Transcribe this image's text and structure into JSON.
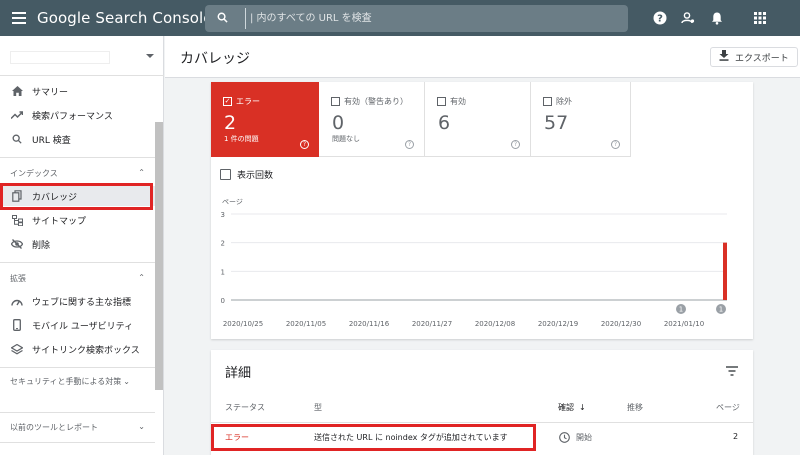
{
  "app": {
    "title": "Google Search Console",
    "search_placeholder": "| 内のすべての URL を検査"
  },
  "topbar_icons": [
    "help-icon",
    "account-settings-icon",
    "notifications-icon",
    "apps-grid-icon"
  ],
  "sidebar": {
    "property_value": "",
    "items_top": [
      {
        "label": "サマリー",
        "icon": "home-icon"
      },
      {
        "label": "検索パフォーマンス",
        "icon": "trending-up-icon"
      },
      {
        "label": "URL 検査",
        "icon": "search-icon"
      }
    ],
    "section_index": {
      "title": "インデックス"
    },
    "items_index": [
      {
        "label": "カバレッジ",
        "icon": "file-copy-icon"
      },
      {
        "label": "サイトマップ",
        "icon": "sitemap-icon"
      },
      {
        "label": "削除",
        "icon": "visibility-off-icon"
      }
    ],
    "section_enhance": {
      "title": "拡張"
    },
    "items_enhance": [
      {
        "label": "ウェブに関する主な指標",
        "icon": "speed-icon"
      },
      {
        "label": "モバイル ユーザビリティ",
        "icon": "smartphone-icon"
      },
      {
        "label": "サイトリンク検索ボックス",
        "icon": "layers-icon"
      }
    ],
    "section_security": {
      "title": "セキュリティと手動による対策"
    },
    "section_legacy": {
      "title": "以前のツールとレポート"
    }
  },
  "header": {
    "title": "カバレッジ",
    "export_label": "エクスポート"
  },
  "tiles": [
    {
      "label": "エラー",
      "count": "2",
      "sub": "1 件の問題",
      "checked": true
    },
    {
      "label": "有効（警告あり）",
      "count": "0",
      "sub": "問題なし",
      "checked": false
    },
    {
      "label": "有効",
      "count": "6",
      "sub": "",
      "checked": false
    },
    {
      "label": "除外",
      "count": "57",
      "sub": "",
      "checked": false
    }
  ],
  "impressions_label": "表示回数",
  "chart_data": {
    "type": "bar",
    "ylabel": "ページ",
    "ylim": [
      0,
      3
    ],
    "yticks": [
      "0",
      "1",
      "2",
      "3"
    ],
    "xticks": [
      "2020/10/25",
      "2020/11/05",
      "2020/11/16",
      "2020/11/27",
      "2020/12/08",
      "2020/12/19",
      "2020/12/30",
      "2021/01/10"
    ],
    "series": [
      {
        "values": [
          0,
          0,
          0,
          0,
          0,
          0,
          0,
          0,
          2
        ]
      }
    ],
    "annotations": [
      "1",
      "1"
    ],
    "color": "#d93025"
  },
  "details": {
    "title": "詳細",
    "columns": [
      "ステータス",
      "型",
      "確認",
      "推移",
      "ページ"
    ],
    "rows": [
      {
        "status": "エラー",
        "type": "送信された URL に noindex タグが追加されています",
        "validation": "開始",
        "pages": "2"
      }
    ]
  },
  "colors": {
    "topbar": "#455a64",
    "error": "#d93025",
    "highlight": "#e02424"
  }
}
